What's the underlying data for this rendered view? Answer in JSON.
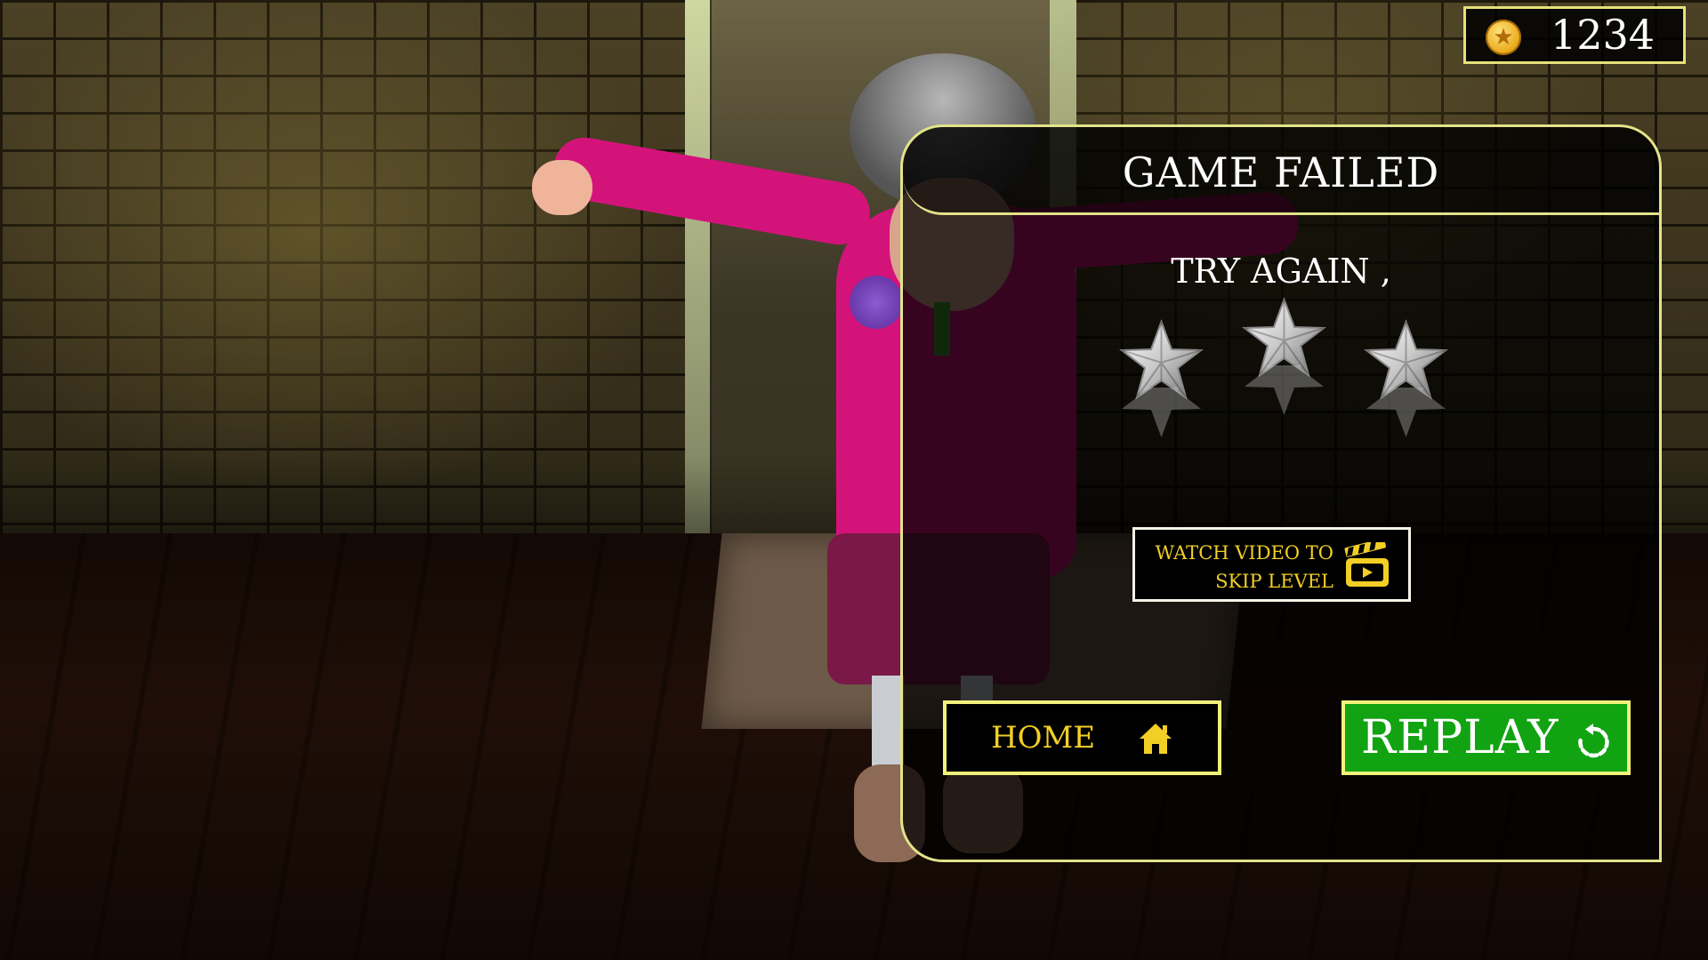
{
  "hud": {
    "coins": "1234",
    "coin_icon": "gold-star-coin-icon"
  },
  "dialog": {
    "title": "GAME FAILED",
    "subtitle": "TRY AGAIN ,",
    "stars_earned": 0,
    "stars_total": 3,
    "watch_video": {
      "line1": "WATCH VIDEO TO",
      "line2": "SKIP LEVEL",
      "icon": "clapperboard-icon"
    },
    "home_button": {
      "label": "HOME",
      "icon": "home-icon"
    },
    "replay_button": {
      "label": "REPLAY",
      "icon": "replay-icon"
    }
  },
  "colors": {
    "border": "#e3e38a",
    "accent_yellow": "#f2cf25",
    "replay_green": "#12a312",
    "star_silver": "#c9c9c9"
  }
}
